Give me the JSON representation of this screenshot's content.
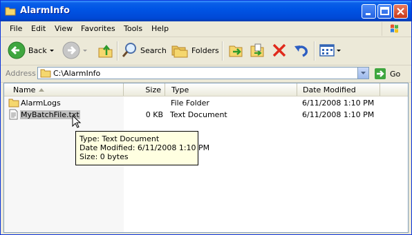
{
  "window": {
    "title": "AlarmInfo"
  },
  "menu": [
    "File",
    "Edit",
    "View",
    "Favorites",
    "Tools",
    "Help"
  ],
  "toolbar": {
    "back": "Back",
    "search": "Search",
    "folders": "Folders"
  },
  "address": {
    "label": "Address",
    "value": "C:\\AlarmInfo",
    "go": "Go"
  },
  "columns": {
    "name": "Name",
    "size": "Size",
    "type": "Type",
    "date": "Date Modified"
  },
  "files": [
    {
      "name": "AlarmLogs",
      "size": "",
      "type": "File Folder",
      "date": "6/11/2008 1:10 PM",
      "icon": "folder-icon"
    },
    {
      "name": "MyBatchFile.txt",
      "size": "0 KB",
      "type": "Text Document",
      "date": "6/11/2008 1:10 PM",
      "icon": "text-file-icon"
    }
  ],
  "tooltip": {
    "type": "Type: Text Document",
    "date": "Date Modified: 6/11/2008 1:10 PM",
    "size": "Size: 0 bytes"
  },
  "colors": {
    "titlebar": "#0055e5",
    "chrome": "#ece9d8",
    "tooltip_bg": "#ffffe1"
  }
}
